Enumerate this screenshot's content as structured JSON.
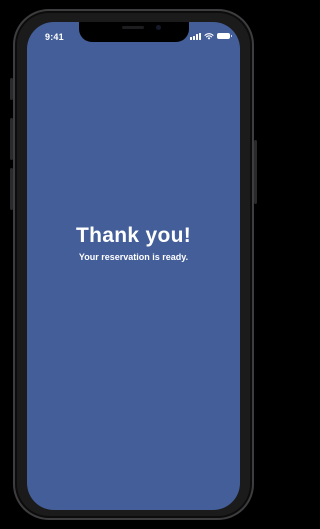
{
  "status_bar": {
    "time": "9:41",
    "icons": [
      "signal-icon",
      "wifi-icon",
      "battery-icon"
    ]
  },
  "confirmation": {
    "title": "Thank you!",
    "message": "Your reservation is ready."
  },
  "colors": {
    "screen_background": "#435e98",
    "text": "#ffffff",
    "device_frame": "#1b1b1c"
  }
}
